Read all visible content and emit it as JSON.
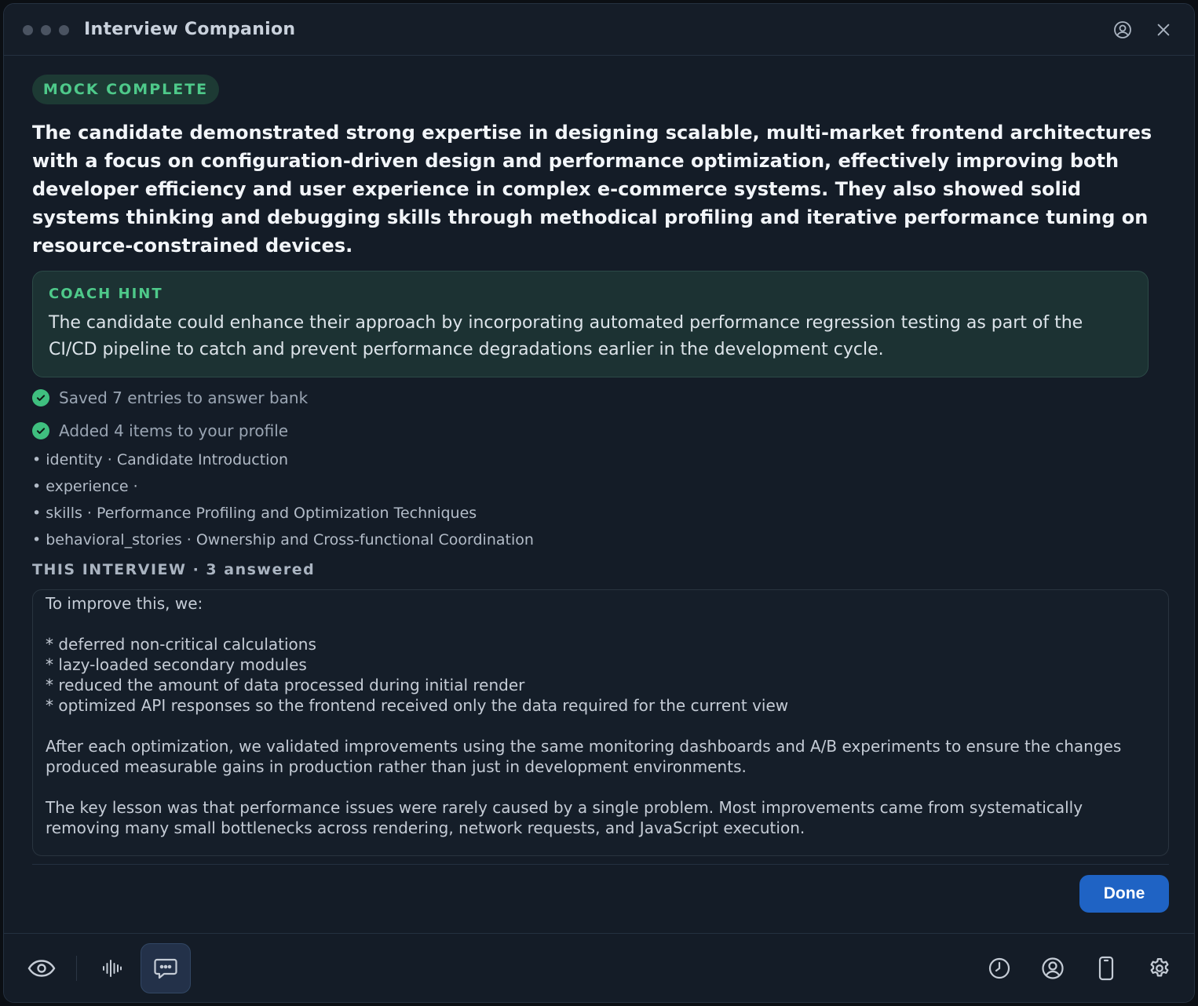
{
  "window": {
    "title": "Interview Companion"
  },
  "header_icons": [
    "user-circle-icon",
    "close-icon"
  ],
  "badge": "MOCK COMPLETE",
  "summary": "The candidate demonstrated strong expertise in designing scalable, multi-market frontend architectures with a focus on configuration-driven design and performance optimization, effectively improving both developer efficiency and user experience in complex e-commerce systems. They also showed solid systems thinking and debugging skills through methodical profiling and iterative performance tuning on resource-constrained devices.",
  "coach_hint": {
    "title": "COACH HINT",
    "text": "The candidate could enhance their approach by incorporating automated performance regression testing as part of the CI/CD pipeline to catch and prevent performance degradations earlier in the development cycle."
  },
  "status": {
    "saved": "Saved 7 entries to answer bank",
    "added": "Added 4 items to your profile"
  },
  "profile_items": [
    "• identity · Candidate Introduction",
    "• experience · ",
    "• skills · Performance Profiling and Optimization Techniques",
    "• behavioral_stories · Ownership and Cross-functional Coordination"
  ],
  "interview": {
    "section_title": "THIS INTERVIEW · 3 answered",
    "answer_text": "To improve this, we:\n\n* deferred non-critical calculations\n* lazy-loaded secondary modules\n* reduced the amount of data processed during initial render\n* optimized API responses so the frontend received only the data required for the current view\n\nAfter each optimization, we validated improvements using the same monitoring dashboards and A/B experiments to ensure the changes produced measurable gains in production rather than just in development environments.\n\nThe key lesson was that performance issues were rarely caused by a single problem. Most improvements came from systematically removing many small bottlenecks across rendering, network requests, and JavaScript execution."
  },
  "actions": {
    "done_label": "Done"
  },
  "toolbar": {
    "left": [
      "eye-icon",
      "waveform-icon",
      "chat-icon"
    ],
    "active": "chat-icon",
    "right": [
      "history-icon",
      "profile-icon",
      "phone-icon",
      "settings-icon"
    ]
  },
  "colors": {
    "accent_green": "#4ec98a",
    "primary_button": "#1f63c4",
    "background": "#141c27"
  }
}
